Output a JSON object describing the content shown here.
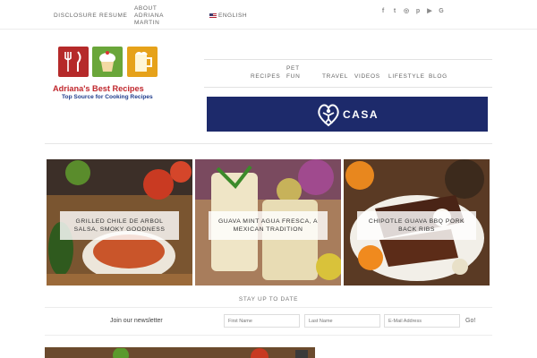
{
  "topnav": {
    "items": [
      {
        "label": "DISCLOSURE"
      },
      {
        "label": "RESUME"
      },
      {
        "label": "ABOUT ADRIANA MARTIN"
      }
    ],
    "language": "ENGLISH"
  },
  "social": [
    {
      "icon": "facebook-icon",
      "glyph": "f"
    },
    {
      "icon": "twitter-icon",
      "glyph": "t"
    },
    {
      "icon": "instagram-icon",
      "glyph": "◎"
    },
    {
      "icon": "pinterest-icon",
      "glyph": "p"
    },
    {
      "icon": "youtube-icon",
      "glyph": "▶"
    },
    {
      "icon": "googleplus-icon",
      "glyph": "G"
    }
  ],
  "logo": {
    "title": "Adriana's Best Recipes",
    "subtitle": "Top Source for Cooking Recipes"
  },
  "mainnav": {
    "items": [
      {
        "label": "RECIPES"
      },
      {
        "label": "PET FUN"
      },
      {
        "label": "TRAVEL"
      },
      {
        "label": "VIDEOS"
      },
      {
        "label": "LIFESTYLE"
      },
      {
        "label": "BLOG"
      }
    ]
  },
  "banner": {
    "text": "CASA",
    "color": "#1d2a6b"
  },
  "cards": [
    {
      "label": "GRILLED CHILE DE ARBOL SALSA, SMOKY GOODNESS"
    },
    {
      "label": "GUAVA MINT AGUA FRESCA, A MEXICAN TRADITION"
    },
    {
      "label": "CHIPOTLE GUAVA BBQ PORK BACK RIBS"
    }
  ],
  "newsletter": {
    "heading": "STAY UP TO DATE",
    "label": "Join our newsletter",
    "first_name_placeholder": "First Name",
    "last_name_placeholder": "Last Name",
    "email_placeholder": "E-Mail Address",
    "submit": "Go!"
  }
}
